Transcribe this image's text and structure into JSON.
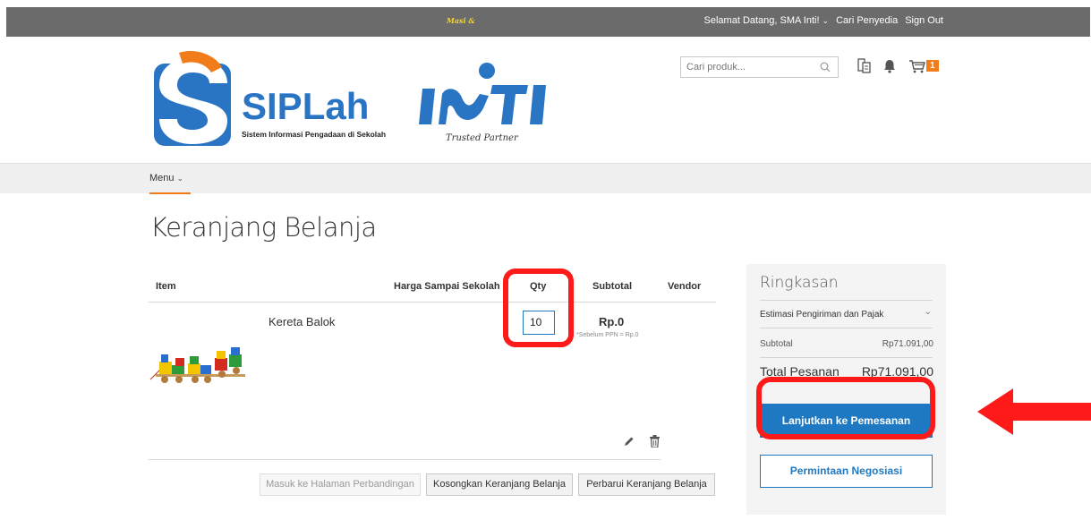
{
  "topbar": {
    "tagline": "Masi &",
    "welcome": "Selamat Datang, SMA Inti!",
    "find_provider": "Cari Penyedia",
    "sign_out": "Sign Out"
  },
  "brand": {
    "name": "SIPLah",
    "subtitle": "Sistem Informasi Pengadaan di Sekolah",
    "partner_name": "INTI",
    "partner_tagline": "Trusted Partner"
  },
  "search": {
    "placeholder": "Cari produk..."
  },
  "cart_badge": "1",
  "menu": {
    "label": "Menu"
  },
  "page_title": "Keranjang Belanja",
  "table": {
    "headers": [
      "Item",
      "Harga Sampai Sekolah",
      "Qty",
      "Subtotal",
      "Vendor"
    ],
    "items": [
      {
        "name": "Kereta Balok",
        "qty": "10",
        "subtotal": "Rp.0",
        "subtotal_note": "*Sebelum PPN = Rp.0"
      }
    ]
  },
  "actions": {
    "compare": "Masuk ke Halaman Perbandingan",
    "empty_cart": "Kosongkan Keranjang Belanja",
    "update_cart": "Perbarui Keranjang Belanja"
  },
  "summary": {
    "title": "Ringkasan",
    "estimate": "Estimasi Pengiriman dan Pajak",
    "subtotal_label": "Subtotal",
    "subtotal_value": "Rp71.091,00",
    "total_label": "Total Pesanan",
    "total_value": "Rp71.091,00",
    "checkout": "Lanjutkan ke Pemesanan",
    "negotiate": "Permintaan Negosiasi"
  },
  "colors": {
    "topbar": "#6b6b6b",
    "accent_orange": "#f07d1a",
    "primary_blue": "#1f79c2",
    "highlight_red": "#ff1a1a"
  },
  "icons": [
    "search-icon",
    "compare-icon",
    "bell-icon",
    "cart-icon",
    "chevron-down-icon",
    "edit-icon",
    "trash-icon",
    "arrow-left-icon"
  ]
}
